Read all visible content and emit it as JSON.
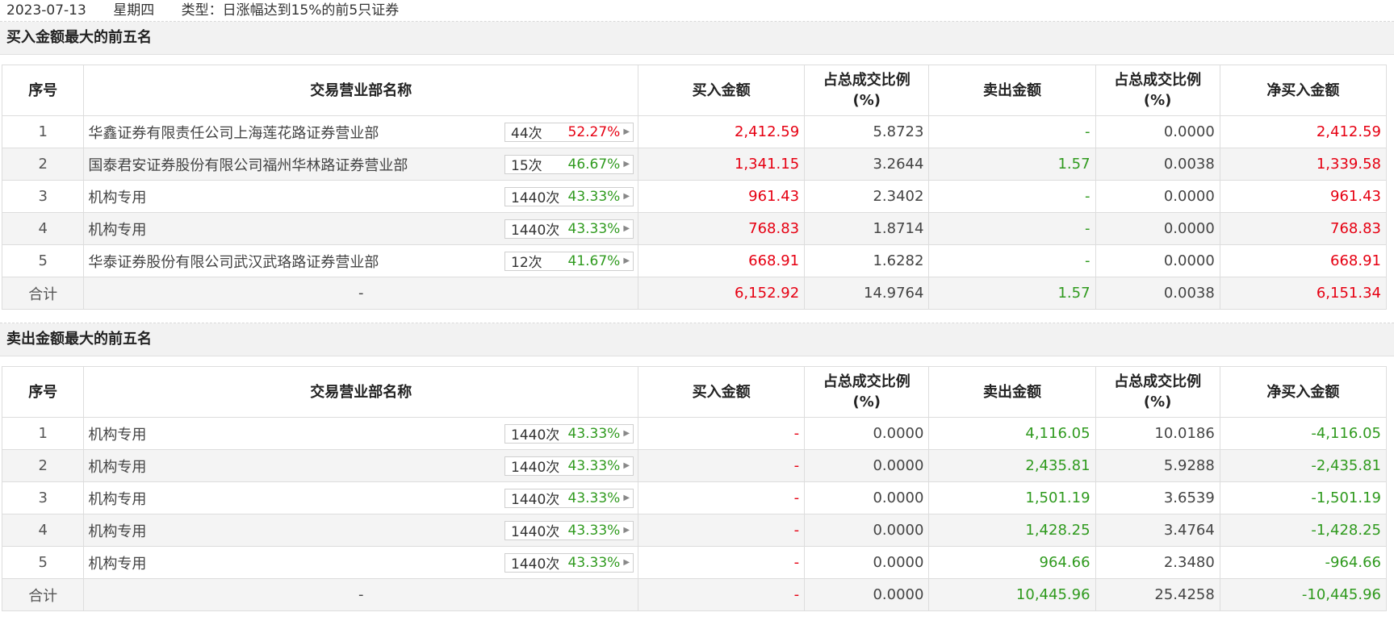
{
  "header": {
    "date": "2023-07-13",
    "weekday": "星期四",
    "type": "类型：日涨幅达到15%的前5只证券"
  },
  "columns": {
    "idx": "序号",
    "dept": "交易营业部名称",
    "buy": "买入金额",
    "ratio_line1": "占总成交比例",
    "ratio_line2": "(%)",
    "sell": "卖出金额",
    "net": "净买入金额"
  },
  "buy_top5": {
    "title": "买入金额最大的前五名",
    "rows": [
      {
        "idx": "1",
        "name": "华鑫证券有限责任公司上海莲花路证券营业部",
        "count": "44次",
        "rate": "52.27%",
        "rate_color": "red",
        "buy": "2,412.59",
        "buy_ratio": "5.8723",
        "sell": "-",
        "sell_ratio": "0.0000",
        "net": "2,412.59"
      },
      {
        "idx": "2",
        "name": "国泰君安证券股份有限公司福州华林路证券营业部",
        "count": "15次",
        "rate": "46.67%",
        "rate_color": "green",
        "buy": "1,341.15",
        "buy_ratio": "3.2644",
        "sell": "1.57",
        "sell_ratio": "0.0038",
        "net": "1,339.58"
      },
      {
        "idx": "3",
        "name": "机构专用",
        "count": "1440次",
        "rate": "43.33%",
        "rate_color": "green",
        "buy": "961.43",
        "buy_ratio": "2.3402",
        "sell": "-",
        "sell_ratio": "0.0000",
        "net": "961.43"
      },
      {
        "idx": "4",
        "name": "机构专用",
        "count": "1440次",
        "rate": "43.33%",
        "rate_color": "green",
        "buy": "768.83",
        "buy_ratio": "1.8714",
        "sell": "-",
        "sell_ratio": "0.0000",
        "net": "768.83"
      },
      {
        "idx": "5",
        "name": "华泰证券股份有限公司武汉武珞路证券营业部",
        "count": "12次",
        "rate": "41.67%",
        "rate_color": "green",
        "buy": "668.91",
        "buy_ratio": "1.6282",
        "sell": "-",
        "sell_ratio": "0.0000",
        "net": "668.91"
      }
    ],
    "total": {
      "label": "合计",
      "name": "-",
      "buy": "6,152.92",
      "buy_ratio": "14.9764",
      "sell": "1.57",
      "sell_ratio": "0.0038",
      "net": "6,151.34"
    }
  },
  "sell_top5": {
    "title": "卖出金额最大的前五名",
    "rows": [
      {
        "idx": "1",
        "name": "机构专用",
        "count": "1440次",
        "rate": "43.33%",
        "rate_color": "green",
        "buy": "-",
        "buy_ratio": "0.0000",
        "sell": "4,116.05",
        "sell_ratio": "10.0186",
        "net": "-4,116.05"
      },
      {
        "idx": "2",
        "name": "机构专用",
        "count": "1440次",
        "rate": "43.33%",
        "rate_color": "green",
        "buy": "-",
        "buy_ratio": "0.0000",
        "sell": "2,435.81",
        "sell_ratio": "5.9288",
        "net": "-2,435.81"
      },
      {
        "idx": "3",
        "name": "机构专用",
        "count": "1440次",
        "rate": "43.33%",
        "rate_color": "green",
        "buy": "-",
        "buy_ratio": "0.0000",
        "sell": "1,501.19",
        "sell_ratio": "3.6539",
        "net": "-1,501.19"
      },
      {
        "idx": "4",
        "name": "机构专用",
        "count": "1440次",
        "rate": "43.33%",
        "rate_color": "green",
        "buy": "-",
        "buy_ratio": "0.0000",
        "sell": "1,428.25",
        "sell_ratio": "3.4764",
        "net": "-1,428.25"
      },
      {
        "idx": "5",
        "name": "机构专用",
        "count": "1440次",
        "rate": "43.33%",
        "rate_color": "green",
        "buy": "-",
        "buy_ratio": "0.0000",
        "sell": "964.66",
        "sell_ratio": "2.3480",
        "net": "-964.66"
      }
    ],
    "total": {
      "label": "合计",
      "name": "-",
      "buy": "-",
      "buy_ratio": "0.0000",
      "sell": "10,445.96",
      "sell_ratio": "25.4258",
      "net": "-10,445.96"
    }
  },
  "colors": {
    "red": "#e60012",
    "green": "#2f9a1e"
  },
  "icons": {
    "pill_arrow": "caret-right-icon"
  }
}
